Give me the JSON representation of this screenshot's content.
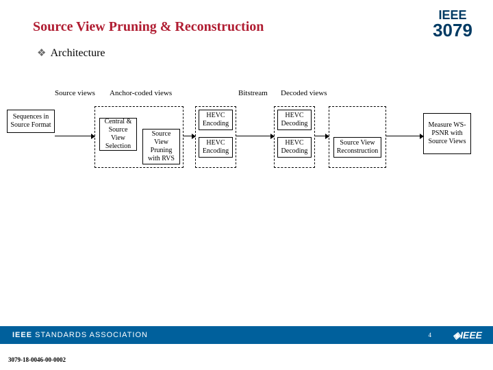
{
  "title": "Source View Pruning & Reconstruction",
  "subhead": "Architecture",
  "stage_labels": {
    "source_views": "Source views",
    "anchor_coded": "Anchor-coded views",
    "bitstream": "Bitstream",
    "decoded": "Decoded views"
  },
  "boxes": {
    "sequences": "Sequences in Source Format",
    "central": "Central & Source View Selection",
    "pruning": "Source View Pruning with RVS",
    "hevc_enc_top": "HEVC Encoding",
    "hevc_enc_bot": "HEVC Encoding",
    "hevc_dec_top": "HEVC Decoding",
    "hevc_dec_bot": "HEVC Decoding",
    "recon": "Source View Reconstruction",
    "measure": "Measure WS-PSNR with Source Views"
  },
  "logo": {
    "ieee": "IEEE",
    "num": "3079"
  },
  "footer": {
    "sa_bold": "IEEE",
    "sa_rest": " STANDARDS ASSOCIATION",
    "pg": "4",
    "ieee": "◈IEEE"
  },
  "docnum": "3079-18-0046-00-0002"
}
